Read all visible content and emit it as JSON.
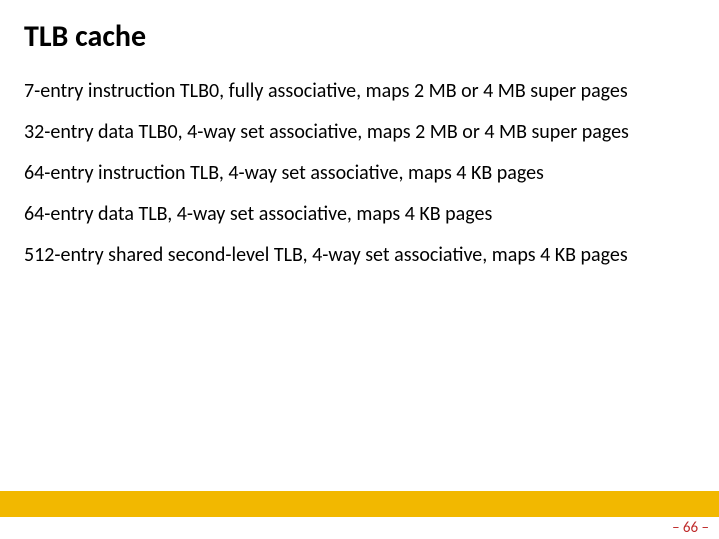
{
  "slide": {
    "title": "TLB cache",
    "items": [
      "7-entry instruction TLB0, fully associative, maps 2 MB or 4 MB super pages",
      "32-entry data TLB0, 4-way set associative, maps 2 MB or 4 MB super pages",
      "64-entry instruction TLB, 4-way set associative, maps 4 KB pages",
      "64-entry data TLB, 4-way set associative, maps 4 KB pages",
      "512-entry shared second-level TLB, 4-way set associative, maps 4 KB pages"
    ],
    "pageNumber": "– 66 –"
  }
}
